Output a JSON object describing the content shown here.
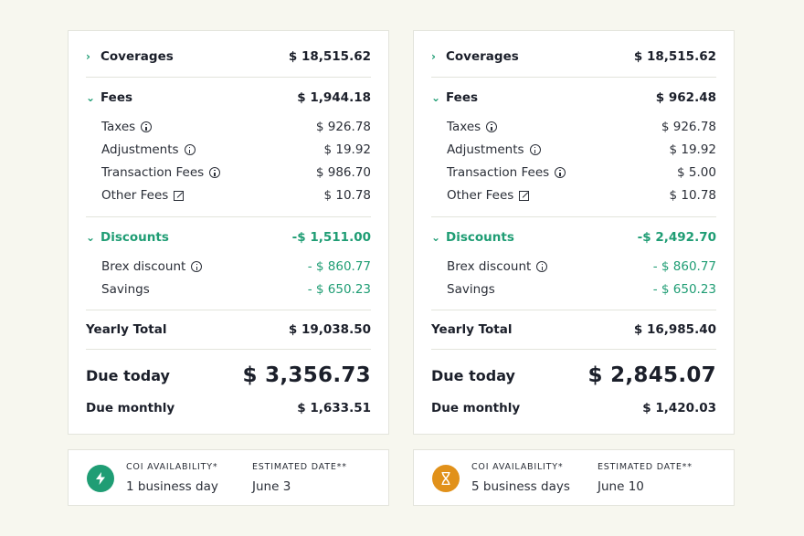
{
  "colors": {
    "accent_green": "#1f9d74",
    "accent_orange": "#e1911a",
    "background": "#f7f7ef"
  },
  "left": {
    "coverages": {
      "label": "Coverages",
      "value": "$ 18,515.62"
    },
    "fees": {
      "label": "Fees",
      "value": "$ 1,944.18",
      "items": [
        {
          "label": "Taxes",
          "value": "$ 926.78"
        },
        {
          "label": "Adjustments",
          "value": "$ 19.92"
        },
        {
          "label": "Transaction Fees",
          "value": "$ 986.70"
        },
        {
          "label": "Other Fees",
          "value": "$ 10.78"
        }
      ]
    },
    "discounts": {
      "label": "Discounts",
      "value": "-$ 1,511.00",
      "items": [
        {
          "label": "Brex discount",
          "value": "- $ 860.77"
        },
        {
          "label": "Savings",
          "value": "- $ 650.23"
        }
      ]
    },
    "yearly_total": {
      "label": "Yearly Total",
      "value": "$ 19,038.50"
    },
    "due_today": {
      "label": "Due today",
      "value": "$ 3,356.73"
    },
    "due_monthly": {
      "label": "Due monthly",
      "value": "$ 1,633.51"
    },
    "info": {
      "icon": "lightning-icon",
      "coi_label": "COI AVAILABILITY*",
      "coi_value": "1 business day",
      "date_label": "ESTIMATED DATE**",
      "date_value": "June 3"
    }
  },
  "right": {
    "coverages": {
      "label": "Coverages",
      "value": "$ 18,515.62"
    },
    "fees": {
      "label": "Fees",
      "value": "$ 962.48",
      "items": [
        {
          "label": "Taxes",
          "value": "$ 926.78"
        },
        {
          "label": "Adjustments",
          "value": "$ 19.92"
        },
        {
          "label": "Transaction Fees",
          "value": "$ 5.00"
        },
        {
          "label": "Other Fees",
          "value": "$ 10.78"
        }
      ]
    },
    "discounts": {
      "label": "Discounts",
      "value": "-$ 2,492.70",
      "items": [
        {
          "label": "Brex discount",
          "value": "- $ 860.77"
        },
        {
          "label": "Savings",
          "value": "- $ 650.23"
        }
      ]
    },
    "yearly_total": {
      "label": "Yearly Total",
      "value": "$ 16,985.40"
    },
    "due_today": {
      "label": "Due today",
      "value": "$ 2,845.07"
    },
    "due_monthly": {
      "label": "Due monthly",
      "value": "$ 1,420.03"
    },
    "info": {
      "icon": "hourglass-icon",
      "coi_label": "COI AVAILABILITY*",
      "coi_value": "5 business days",
      "date_label": "ESTIMATED DATE**",
      "date_value": "June 10"
    }
  }
}
